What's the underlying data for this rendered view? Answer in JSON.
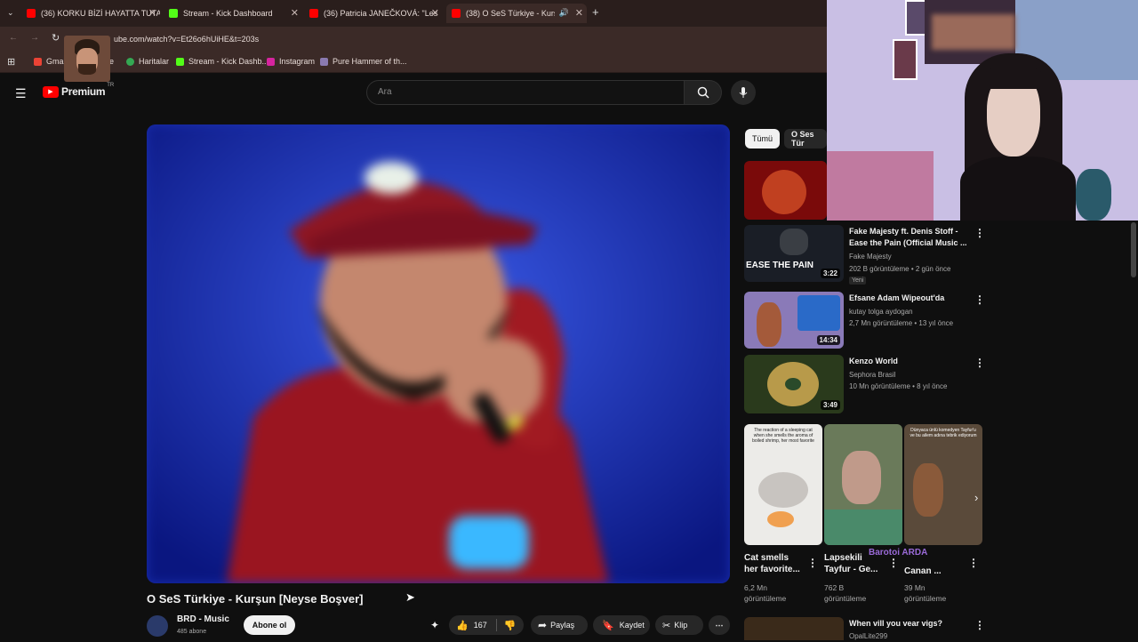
{
  "tabs": [
    {
      "title": "(36) KORKU BİZİ HAYATTA TUTA",
      "color": "#ff0000"
    },
    {
      "title": "Stream - Kick Dashboard",
      "color": "#53fc18"
    },
    {
      "title": "(36) Patricia JANEČKOVÁ: \"Les",
      "color": "#ff0000"
    },
    {
      "title": "(38) O SeS Türkiye - Kurşun",
      "color": "#ff0000"
    }
  ],
  "new_tab": "+",
  "address": "ube.com/watch?v=Et26o6hUiHE&t=203s",
  "bookmarks": [
    "Gmai",
    "e",
    "Haritalar",
    "Stream - Kick Dashb...",
    "Instagram",
    "Pure Hammer of th..."
  ],
  "yt": {
    "brand": "Premium",
    "country": "TR",
    "search_placeholder": "Ara"
  },
  "video": {
    "title": "O SeS Türkiye - Kurşun [Neyse Boşver]",
    "channel": "BRD - Music",
    "subs": "485 abone",
    "subscribe": "Abone ol",
    "likes": "167",
    "share": "Paylaş",
    "save": "Kaydet",
    "clip": "Klip"
  },
  "chips": [
    "Tümü",
    "O Ses Tür"
  ],
  "recs": [
    {
      "title1": "Fake Majesty ft. Denis Stoff -",
      "title2": "Ease the Pain (Official Music ...",
      "channel": "Fake Majesty",
      "meta": "202 B görüntüleme • 2 gün önce",
      "badge": "Yeni",
      "duration": "3:22",
      "thumb_text": "EASE THE PAIN"
    },
    {
      "title1": "Efsane Adam Wipeout'da",
      "title2": "",
      "channel": "kutay tolga aydogan",
      "meta": "2,7 Mn görüntüleme • 13 yıl önce",
      "duration": "14:34"
    },
    {
      "title1": "Kenzo World",
      "title2": "",
      "channel": "Sephora Brasil",
      "meta": "10 Mn görüntüleme • 8 yıl önce",
      "duration": "3:49"
    }
  ],
  "shorts": [
    {
      "t1": "Cat smells",
      "t2": "her favorite...",
      "v1": "6,2 Mn",
      "v2": "görüntüleme",
      "caption": "The reaction of a sleeping cat when she smells the aroma of boiled shrimp, her most favorite"
    },
    {
      "t1": "Lapsekili",
      "t2": "Tayfur - Ge...",
      "v1": "762 B",
      "v2": "görüntüleme"
    },
    {
      "t1": "Barotoi ARDA",
      "t2": "Canan ...",
      "v1": "39 Mn",
      "v2": "görüntüleme",
      "caption": "Dünyaca ünlü komedyen Tayfur'u ve bu ailem adına tebrik ediyorum"
    }
  ],
  "last_rec": {
    "title": "When vill you vear vigs?",
    "channel": "OpalLite299"
  }
}
